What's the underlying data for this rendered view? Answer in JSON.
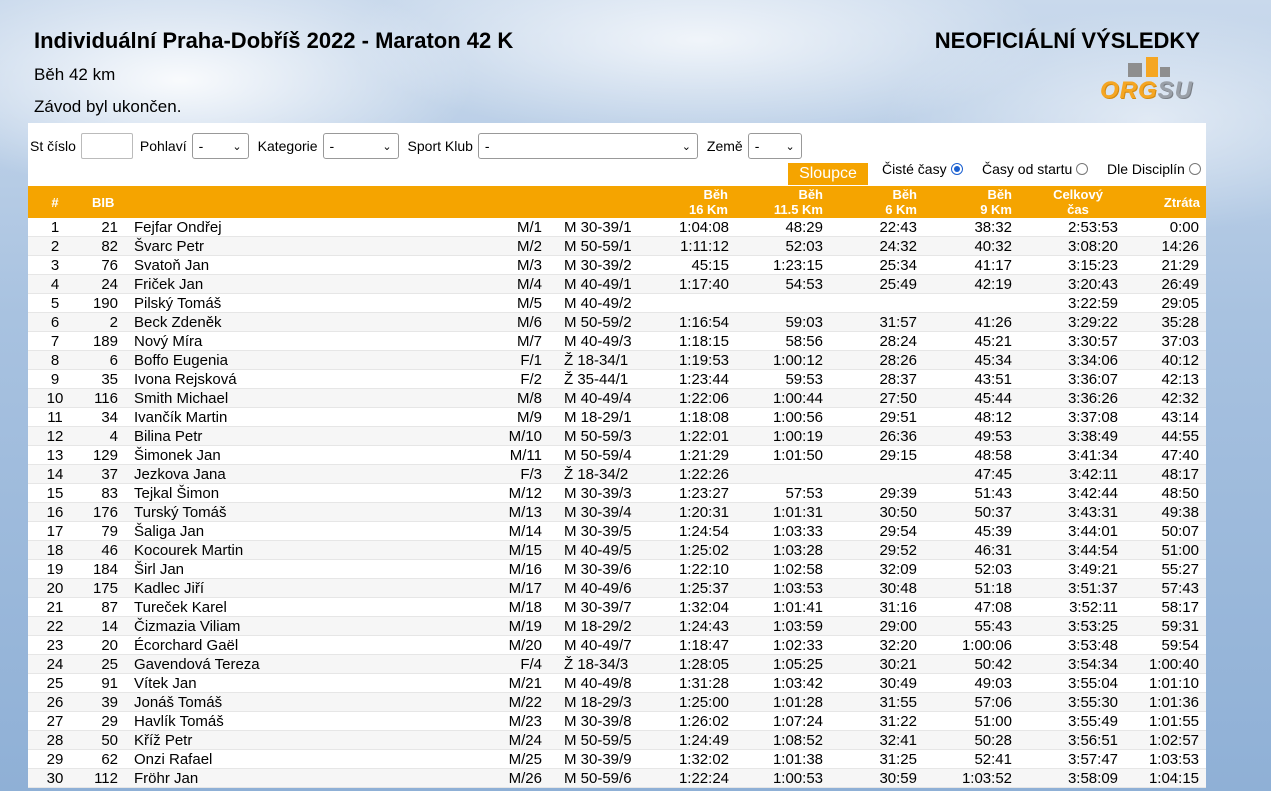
{
  "header": {
    "title": "Individuální Praha-Dobříš 2022 - Maraton 42 K",
    "unofficial": "NEOFICIÁLNÍ VÝSLEDKY",
    "subtitle": "Běh 42 km",
    "status": "Závod byl ukončen.",
    "logo_text_a": "ORG",
    "logo_text_b": "SU"
  },
  "filters": {
    "st_cislo_label": "St číslo",
    "pohlavi_label": "Pohlaví",
    "pohlavi_value": "-",
    "kategorie_label": "Kategorie",
    "kategorie_value": "-",
    "klub_label": "Sport Klub",
    "klub_value": "-",
    "zeme_label": "Země",
    "zeme_value": "-",
    "columns_button": "Sloupce",
    "radio_clean": "Čisté časy",
    "radio_start": "Časy od startu",
    "radio_disc": "Dle Disciplín"
  },
  "colors": {
    "accent": "#f5a400"
  },
  "columns": {
    "rank": "#",
    "bib": "BIB",
    "beh16_a": "Běh",
    "beh16_b": "16 Km",
    "beh115_a": "Běh",
    "beh115_b": "11.5 Km",
    "beh6_a": "Běh",
    "beh6_b": "6 Km",
    "beh9_a": "Běh",
    "beh9_b": "9 Km",
    "total_a": "Celkový",
    "total_b": "čas",
    "loss": "Ztráta"
  },
  "rows": [
    [
      "1",
      "21",
      "Fejfar Ondřej",
      "M/1",
      "M 30-39/1",
      "1:04:08",
      "48:29",
      "22:43",
      "38:32",
      "2:53:53",
      "0:00"
    ],
    [
      "2",
      "82",
      "Švarc Petr",
      "M/2",
      "M 50-59/1",
      "1:11:12",
      "52:03",
      "24:32",
      "40:32",
      "3:08:20",
      "14:26"
    ],
    [
      "3",
      "76",
      "Svatoň Jan",
      "M/3",
      "M 30-39/2",
      "45:15",
      "1:23:15",
      "25:34",
      "41:17",
      "3:15:23",
      "21:29"
    ],
    [
      "4",
      "24",
      "Friček Jan",
      "M/4",
      "M 40-49/1",
      "1:17:40",
      "54:53",
      "25:49",
      "42:19",
      "3:20:43",
      "26:49"
    ],
    [
      "5",
      "190",
      "Pilský Tomáš",
      "M/5",
      "M 40-49/2",
      "",
      "",
      "",
      "",
      "3:22:59",
      "29:05"
    ],
    [
      "6",
      "2",
      "Beck Zdeněk",
      "M/6",
      "M 50-59/2",
      "1:16:54",
      "59:03",
      "31:57",
      "41:26",
      "3:29:22",
      "35:28"
    ],
    [
      "7",
      "189",
      "Nový Míra",
      "M/7",
      "M 40-49/3",
      "1:18:15",
      "58:56",
      "28:24",
      "45:21",
      "3:30:57",
      "37:03"
    ],
    [
      "8",
      "6",
      "Boffo Eugenia",
      "F/1",
      "Ž 18-34/1",
      "1:19:53",
      "1:00:12",
      "28:26",
      "45:34",
      "3:34:06",
      "40:12"
    ],
    [
      "9",
      "35",
      "Ivona Rejsková",
      "F/2",
      "Ž 35-44/1",
      "1:23:44",
      "59:53",
      "28:37",
      "43:51",
      "3:36:07",
      "42:13"
    ],
    [
      "10",
      "116",
      "Smith Michael",
      "M/8",
      "M 40-49/4",
      "1:22:06",
      "1:00:44",
      "27:50",
      "45:44",
      "3:36:26",
      "42:32"
    ],
    [
      "11",
      "34",
      "Ivančík Martin",
      "M/9",
      "M 18-29/1",
      "1:18:08",
      "1:00:56",
      "29:51",
      "48:12",
      "3:37:08",
      "43:14"
    ],
    [
      "12",
      "4",
      "Bilina Petr",
      "M/10",
      "M 50-59/3",
      "1:22:01",
      "1:00:19",
      "26:36",
      "49:53",
      "3:38:49",
      "44:55"
    ],
    [
      "13",
      "129",
      "Šimonek Jan",
      "M/11",
      "M 50-59/4",
      "1:21:29",
      "1:01:50",
      "29:15",
      "48:58",
      "3:41:34",
      "47:40"
    ],
    [
      "14",
      "37",
      "Jezkova Jana",
      "F/3",
      "Ž 18-34/2",
      "1:22:26",
      "",
      "",
      "47:45",
      "3:42:11",
      "48:17"
    ],
    [
      "15",
      "83",
      "Tejkal Šimon",
      "M/12",
      "M 30-39/3",
      "1:23:27",
      "57:53",
      "29:39",
      "51:43",
      "3:42:44",
      "48:50"
    ],
    [
      "16",
      "176",
      "Turský Tomáš",
      "M/13",
      "M 30-39/4",
      "1:20:31",
      "1:01:31",
      "30:50",
      "50:37",
      "3:43:31",
      "49:38"
    ],
    [
      "17",
      "79",
      "Šaliga Jan",
      "M/14",
      "M 30-39/5",
      "1:24:54",
      "1:03:33",
      "29:54",
      "45:39",
      "3:44:01",
      "50:07"
    ],
    [
      "18",
      "46",
      "Kocourek Martin",
      "M/15",
      "M 40-49/5",
      "1:25:02",
      "1:03:28",
      "29:52",
      "46:31",
      "3:44:54",
      "51:00"
    ],
    [
      "19",
      "184",
      "Širl Jan",
      "M/16",
      "M 30-39/6",
      "1:22:10",
      "1:02:58",
      "32:09",
      "52:03",
      "3:49:21",
      "55:27"
    ],
    [
      "20",
      "175",
      "Kadlec Jiří",
      "M/17",
      "M 40-49/6",
      "1:25:37",
      "1:03:53",
      "30:48",
      "51:18",
      "3:51:37",
      "57:43"
    ],
    [
      "21",
      "87",
      "Tureček Karel",
      "M/18",
      "M 30-39/7",
      "1:32:04",
      "1:01:41",
      "31:16",
      "47:08",
      "3:52:11",
      "58:17"
    ],
    [
      "22",
      "14",
      "Čizmazia Viliam",
      "M/19",
      "M 18-29/2",
      "1:24:43",
      "1:03:59",
      "29:00",
      "55:43",
      "3:53:25",
      "59:31"
    ],
    [
      "23",
      "20",
      "Écorchard Gaël",
      "M/20",
      "M 40-49/7",
      "1:18:47",
      "1:02:33",
      "32:20",
      "1:00:06",
      "3:53:48",
      "59:54"
    ],
    [
      "24",
      "25",
      "Gavendová Tereza",
      "F/4",
      "Ž 18-34/3",
      "1:28:05",
      "1:05:25",
      "30:21",
      "50:42",
      "3:54:34",
      "1:00:40"
    ],
    [
      "25",
      "91",
      "Vítek Jan",
      "M/21",
      "M 40-49/8",
      "1:31:28",
      "1:03:42",
      "30:49",
      "49:03",
      "3:55:04",
      "1:01:10"
    ],
    [
      "26",
      "39",
      "Jonáš Tomáš",
      "M/22",
      "M 18-29/3",
      "1:25:00",
      "1:01:28",
      "31:55",
      "57:06",
      "3:55:30",
      "1:01:36"
    ],
    [
      "27",
      "29",
      "Havlík Tomáš",
      "M/23",
      "M 30-39/8",
      "1:26:02",
      "1:07:24",
      "31:22",
      "51:00",
      "3:55:49",
      "1:01:55"
    ],
    [
      "28",
      "50",
      "Kříž Petr",
      "M/24",
      "M 50-59/5",
      "1:24:49",
      "1:08:52",
      "32:41",
      "50:28",
      "3:56:51",
      "1:02:57"
    ],
    [
      "29",
      "62",
      "Onzi Rafael",
      "M/25",
      "M 30-39/9",
      "1:32:02",
      "1:01:38",
      "31:25",
      "52:41",
      "3:57:47",
      "1:03:53"
    ],
    [
      "30",
      "112",
      "Fröhr Jan",
      "M/26",
      "M 50-59/6",
      "1:22:24",
      "1:00:53",
      "30:59",
      "1:03:52",
      "3:58:09",
      "1:04:15"
    ]
  ]
}
